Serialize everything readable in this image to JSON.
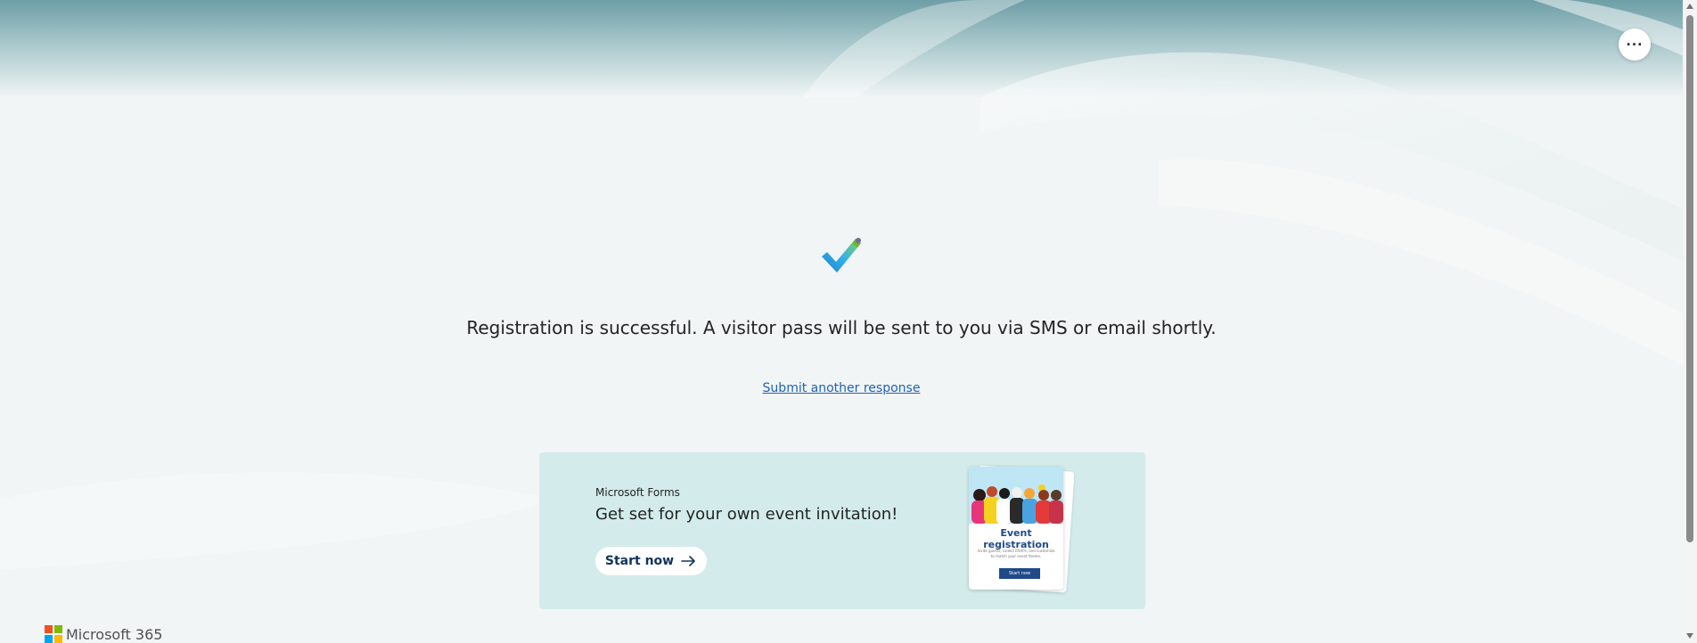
{
  "header": {
    "more_button_label": "...",
    "more_icon": "more-horizontal-icon"
  },
  "confirmation": {
    "icon": "checkmark-icon",
    "message": "Registration is successful. A visitor pass will be sent to you via SMS or email shortly.",
    "submit_another_label": "Submit another response"
  },
  "promo": {
    "product": "Microsoft Forms",
    "headline": "Get set for your own event invitation!",
    "start_label": "Start now",
    "arrow_icon": "arrow-right-icon",
    "illustration": {
      "title": "Event registration",
      "body": "Invite guests, collect RSVPs, and customize to match your event theme.",
      "button_label": "Start now"
    }
  },
  "footer": {
    "brand": "Microsoft 365",
    "logo_colors": [
      "#f25022",
      "#7fba00",
      "#00a4ef",
      "#ffb900"
    ]
  },
  "colors": {
    "link": "#1f62b8",
    "promo_bg": "#d3ebeb",
    "button_text": "#11335a"
  }
}
